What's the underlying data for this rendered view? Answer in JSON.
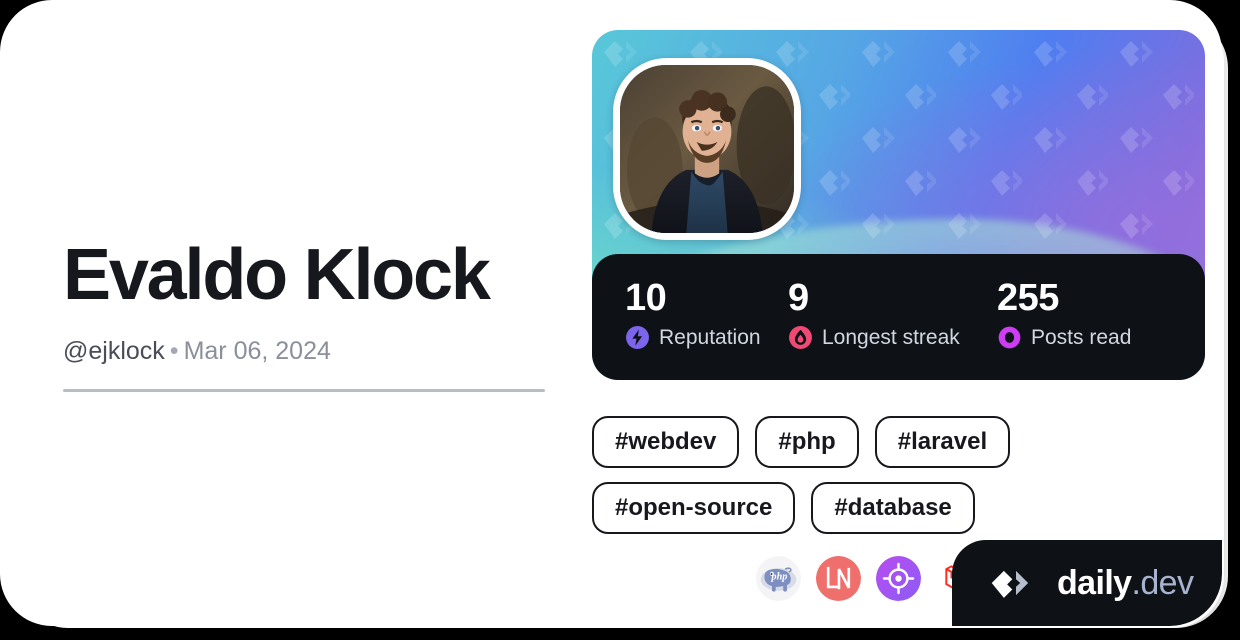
{
  "profile": {
    "name": "Evaldo Klock",
    "handle": "@ejklock",
    "separator": "•",
    "joined_date": "Mar 06, 2024",
    "avatar_alt": "avatar"
  },
  "stats": [
    {
      "value": "10",
      "label": "Reputation",
      "icon": "reputation-bolt-icon",
      "color": "#7C64EC"
    },
    {
      "value": "9",
      "label": "Longest streak",
      "icon": "streak-flame-icon",
      "color": "#F04A74"
    },
    {
      "value": "255",
      "label": "Posts read",
      "icon": "posts-read-ring-icon",
      "color": "#CE3DF3"
    }
  ],
  "tags": [
    {
      "label": "#webdev"
    },
    {
      "label": "#php"
    },
    {
      "label": "#laravel"
    },
    {
      "label": "#open-source"
    },
    {
      "label": "#database"
    }
  ],
  "badges": [
    {
      "name": "php-icon"
    },
    {
      "name": "laravel-news-icon"
    },
    {
      "name": "target-icon"
    },
    {
      "name": "laravel-icon"
    },
    {
      "name": "hacker-news-ycombinator-icon"
    }
  ],
  "brand": {
    "name": "daily",
    "tld": ".dev",
    "logo": "daily-dev-logo-icon"
  },
  "theme": {
    "page_background": "#000000",
    "card_background": "#ffffff",
    "dark_panel": "#0e1217",
    "text_primary": "#17181d",
    "text_muted": "#8b8f9c",
    "divider": "#b9bcc4"
  }
}
